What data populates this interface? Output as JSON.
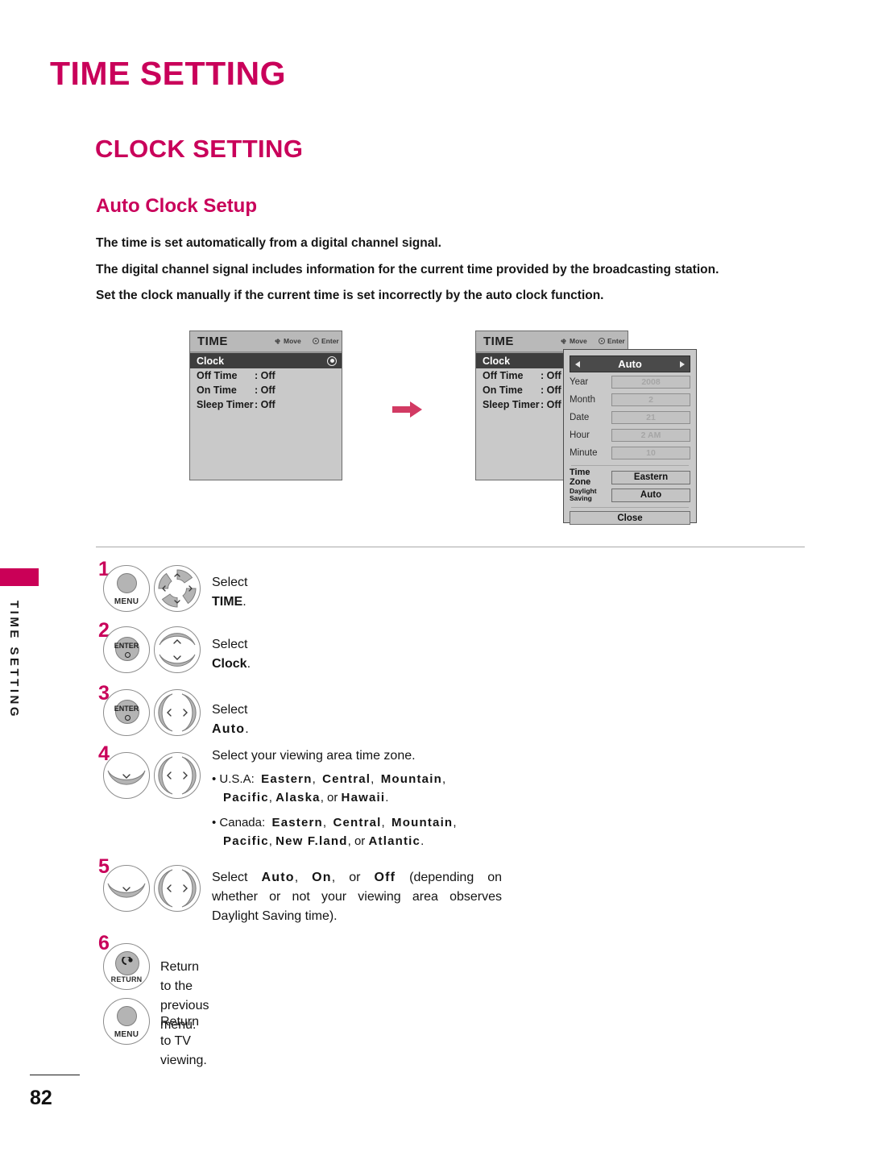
{
  "page": {
    "chapter_title": "TIME SETTING",
    "section_title": "CLOCK SETTING",
    "subsection_title": "Auto Clock Setup",
    "page_number": "82",
    "sidebar_vertical_label": "TIME SETTING",
    "accent_color": "#c9005a"
  },
  "intro": {
    "line1": "The time is set automatically from a digital channel signal.",
    "line2": "The digital channel signal includes information for the current time provided by the broadcasting station.",
    "line3": "Set the clock manually if the current time is set incorrectly by the auto clock function."
  },
  "osd_left": {
    "title": "TIME",
    "hint_move": "Move",
    "hint_enter": "Enter",
    "rows": [
      {
        "key": "Clock",
        "value": "",
        "selected": true
      },
      {
        "key": "Off Time",
        "value": ": Off",
        "selected": false
      },
      {
        "key": "On Time",
        "value": ": Off",
        "selected": false
      },
      {
        "key": "Sleep Timer",
        "value": ": Off",
        "selected": false
      }
    ]
  },
  "osd_right": {
    "title": "TIME",
    "hint_move": "Move",
    "hint_enter": "Enter",
    "rows": [
      {
        "key": "Clock",
        "value": "",
        "selected": true
      },
      {
        "key": "Off Time",
        "value": ": Off",
        "selected": false
      },
      {
        "key": "On Time",
        "value": ": Off",
        "selected": false
      },
      {
        "key": "Sleep Timer",
        "value": ": Off",
        "selected": false
      }
    ],
    "dialog": {
      "header": "Auto",
      "fields": [
        {
          "label": "Year",
          "value": "2008"
        },
        {
          "label": "Month",
          "value": "2"
        },
        {
          "label": "Date",
          "value": "21"
        },
        {
          "label": "Hour",
          "value": "2 AM"
        },
        {
          "label": "Minute",
          "value": "10"
        }
      ],
      "time_zone_label": "Time Zone",
      "time_zone_value": "Eastern",
      "daylight_label_line1": "Daylight",
      "daylight_label_line2": "Saving",
      "daylight_value": "Auto",
      "close_label": "Close"
    }
  },
  "steps": [
    {
      "num": "1",
      "buttons": [
        "MENU",
        "nav-4way"
      ],
      "text_plain": "Select ",
      "text_bold": "TIME",
      "text_tail": "."
    },
    {
      "num": "2",
      "buttons": [
        "ENTER",
        "nav-updown"
      ],
      "text_plain": "Select ",
      "text_bold": "Clock",
      "text_tail": "."
    },
    {
      "num": "3",
      "buttons": [
        "ENTER",
        "nav-leftright"
      ],
      "text_plain": "Select ",
      "text_bold": "Auto",
      "text_tail": "."
    },
    {
      "num": "4",
      "buttons": [
        "nav-down",
        "nav-leftright"
      ],
      "heading": "Select your viewing area time zone.",
      "bullet_usa_label": "U.S.A:",
      "bullet_usa_zones": "Eastern, Central, Mountain, Pacific, Alaska, or Hawaii.",
      "bullet_canada_label": "Canada:",
      "bullet_canada_zones": "Eastern, Central, Mountain, Pacific, New F.land, or Atlantic."
    },
    {
      "num": "5",
      "buttons": [
        "nav-down",
        "nav-leftright"
      ],
      "text": "Select Auto, On, or Off (depending on whether or not your viewing area observes Daylight Saving time)."
    },
    {
      "num": "6",
      "buttons": [
        "RETURN",
        "MENU"
      ],
      "text_return": "Return to the previous menu.",
      "text_menu": "Return to TV viewing."
    }
  ],
  "step_labels": {
    "select": "Select",
    "time": "TIME",
    "clock": "Clock",
    "auto": "Auto",
    "on": "On",
    "off": "Off",
    "menu_button": "MENU",
    "enter_button": "ENTER",
    "return_button": "RETURN"
  },
  "zone_words": {
    "eastern": "Eastern",
    "central": "Central",
    "mountain": "Mountain",
    "pacific": "Pacific",
    "alaska": "Alaska",
    "hawaii": "Hawaii",
    "newfland": "New F.land",
    "atlantic": "Atlantic",
    "or": "or"
  }
}
